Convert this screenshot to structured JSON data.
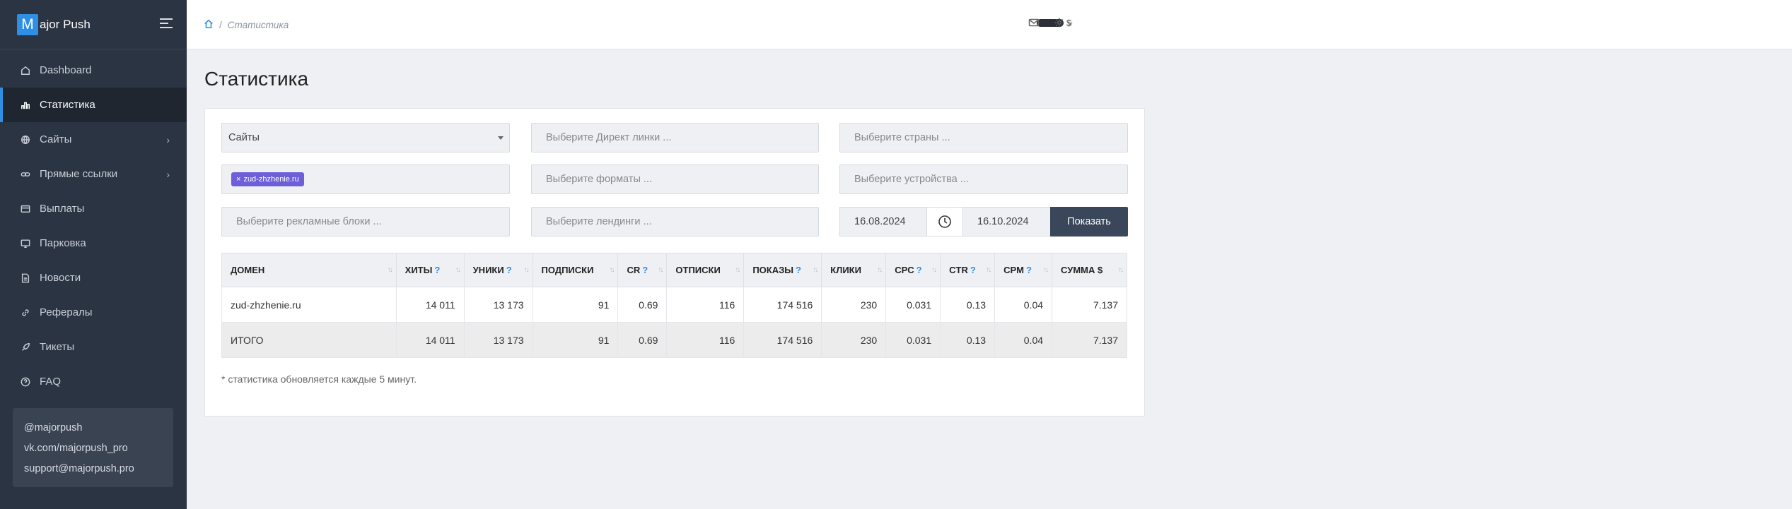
{
  "brand": {
    "logo_letter": "M",
    "logo_text": "ajor Push",
    "accent": "#2f8fe5"
  },
  "menu": [
    {
      "label": "Dashboard",
      "icon": "home-icon"
    },
    {
      "label": "Статистика",
      "icon": "bar-chart-icon",
      "active": true
    },
    {
      "label": "Сайты",
      "icon": "globe-icon",
      "chevron": "›"
    },
    {
      "label": "Прямые ссылки",
      "icon": "link-icon",
      "chevron": "›"
    },
    {
      "label": "Выплаты",
      "icon": "card-icon"
    },
    {
      "label": "Парковка",
      "icon": "monitor-icon"
    },
    {
      "label": "Новости",
      "icon": "document-icon"
    },
    {
      "label": "Рефералы",
      "icon": "chain-icon"
    },
    {
      "label": "Тикеты",
      "icon": "rocket-icon"
    },
    {
      "label": "FAQ",
      "icon": "question-icon"
    }
  ],
  "contacts": [
    "@majorpush",
    "vk.com/majorpush_pro",
    "support@majorpush.pro"
  ],
  "breadcrumb": {
    "separator": "/",
    "current": "Статистика"
  },
  "topbar": {
    "currency": "$"
  },
  "page_title": "Статистика",
  "filters": {
    "sites": "Сайты",
    "direct_links_placeholder": "Выберите Директ линки ...",
    "countries_placeholder": "Выберите страны ...",
    "site_tag": "zud-zhzhenie.ru",
    "tag_remove": "×",
    "formats_placeholder": "Выберите форматы ...",
    "devices_placeholder": "Выберите устройства ...",
    "ad_blocks_placeholder": "Выберите рекламные блоки ...",
    "landings_placeholder": "Выберите лендинги ...",
    "date_from": "16.08.2024",
    "date_to": "16.10.2024",
    "show_button": "Показать"
  },
  "table": {
    "columns": [
      {
        "label": "ДОМЕН",
        "help": ""
      },
      {
        "label": "ХИТЫ",
        "help": "?"
      },
      {
        "label": "УНИКИ",
        "help": "?"
      },
      {
        "label": "ПОДПИСКИ",
        "help": ""
      },
      {
        "label": "CR",
        "help": "?"
      },
      {
        "label": "ОТПИСКИ",
        "help": ""
      },
      {
        "label": "ПОКАЗЫ",
        "help": "?"
      },
      {
        "label": "КЛИКИ",
        "help": ""
      },
      {
        "label": "CPC",
        "help": "?"
      },
      {
        "label": "CTR",
        "help": "?"
      },
      {
        "label": "CPM",
        "help": "?"
      },
      {
        "label": "СУММА $",
        "help": ""
      }
    ],
    "sort_glyph": "↑↓",
    "rows": [
      [
        "zud-zhzhenie.ru",
        "14 011",
        "13 173",
        "91",
        "0.69",
        "116",
        "174 516",
        "230",
        "0.031",
        "0.13",
        "0.04",
        "7.137"
      ]
    ],
    "total": [
      "ИТОГО",
      "14 011",
      "13 173",
      "91",
      "0.69",
      "116",
      "174 516",
      "230",
      "0.031",
      "0.13",
      "0.04",
      "7.137"
    ]
  },
  "note": "* статистика обновляется каждые 5 минут."
}
